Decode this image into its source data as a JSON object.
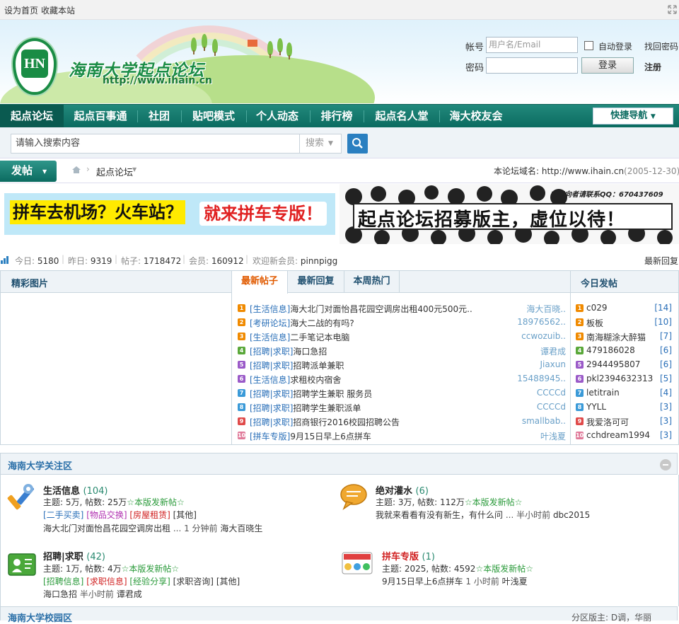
{
  "topbar": {
    "set_home": "设为首页",
    "bookmark": "收藏本站"
  },
  "header": {
    "site_name": "海南大学起点论坛",
    "site_url": "http://www.ihain.cn",
    "emblem_letters": "HN"
  },
  "login": {
    "account_label": "帐号",
    "account_placeholder": "用户名/Email",
    "auto_login": "自动登录",
    "forgot": "找回密码",
    "password_label": "密码",
    "login_button": "登录",
    "register": "注册"
  },
  "nav": {
    "items": [
      "起点论坛",
      "起点百事通",
      "社团",
      "贴吧模式",
      "个人动态",
      "排行榜",
      "起点名人堂",
      "海大校友会"
    ],
    "quick_nav": "快捷导航"
  },
  "search": {
    "placeholder": "请输入搜索内容",
    "type": "搜索"
  },
  "postbar": {
    "post_button": "发帖",
    "breadcrumb": "起点论坛",
    "domain_label": "本论坛域名:",
    "domain": "http://www.ihain.cn",
    "domain_date": "(2005-12-30)"
  },
  "banners": {
    "left_yellow": "拼车去机场？火车站？",
    "left_red": "就来拼车专版！",
    "right_main": "起点论坛招募版主，虚位以待！",
    "right_top": "有意向者请联系QQ：670437609"
  },
  "stats": {
    "today_label": "今日:",
    "today": "5180",
    "yesterday_label": "昨日:",
    "yesterday": "9319",
    "posts_label": "帖子:",
    "posts": "1718472",
    "members_label": "会员:",
    "members": "160912",
    "welcome_label": "欢迎新会员:",
    "new_member": "pinnpigg",
    "latest_reply": "最新回复"
  },
  "panel": {
    "pics_title": "精彩图片",
    "tabs": [
      "最新帖子",
      "最新回复",
      "本周热门"
    ],
    "today_title": "今日发帖",
    "threads": [
      {
        "n": "1",
        "cat": "[生活信息]",
        "title": "海大北门对面怡昌花园空调房出租400元500元..",
        "author": "海大百晓..",
        "color": "#f08a00"
      },
      {
        "n": "2",
        "cat": "[考研论坛]",
        "title": "海大二战的有吗?",
        "author": "18976562..",
        "color": "#f08a00"
      },
      {
        "n": "3",
        "cat": "[生活信息]",
        "title": "二手笔记本电脑",
        "author": "ccwozuib..",
        "color": "#f08a00"
      },
      {
        "n": "4",
        "cat": "[招聘|求职]",
        "title": "海口急招",
        "author": "谭君成",
        "color": "#5aa83a"
      },
      {
        "n": "5",
        "cat": "[招聘|求职]",
        "title": "招聘派单兼职",
        "author": "Jiaxun",
        "color": "#9a5ac8"
      },
      {
        "n": "6",
        "cat": "[生活信息]",
        "title": "求租校内宿舍",
        "author": "15488945..",
        "color": "#9a5ac8"
      },
      {
        "n": "7",
        "cat": "[招聘|求职]",
        "title": "招聘学生兼职 服务员",
        "author": "CCCCd",
        "color": "#3a9ad8"
      },
      {
        "n": "8",
        "cat": "[招聘|求职]",
        "title": "招聘学生兼职派单",
        "author": "CCCCd",
        "color": "#3a9ad8"
      },
      {
        "n": "9",
        "cat": "[招聘|求职]",
        "title": "招商银行2016校园招聘公告",
        "author": "smallbab..",
        "color": "#e04a4a"
      },
      {
        "n": "10",
        "cat": "[拼车专版]",
        "title": "9月15日早上6点拼车",
        "author": "叶浅夏",
        "color": "#e07a9a"
      }
    ],
    "today_posts": [
      {
        "n": "1",
        "name": "c029",
        "count": "[14]",
        "color": "#f08a00"
      },
      {
        "n": "2",
        "name": "板板",
        "count": "[10]",
        "color": "#f08a00"
      },
      {
        "n": "3",
        "name": "南海糊涂大醉猫",
        "count": "[7]",
        "color": "#f08a00"
      },
      {
        "n": "4",
        "name": "479186028",
        "count": "[6]",
        "color": "#5aa83a"
      },
      {
        "n": "5",
        "name": "2944495807",
        "count": "[6]",
        "color": "#9a5ac8"
      },
      {
        "n": "6",
        "name": "pkl2394632313",
        "count": "[5]",
        "color": "#9a5ac8"
      },
      {
        "n": "7",
        "name": "letitrain",
        "count": "[4]",
        "color": "#3a9ad8"
      },
      {
        "n": "8",
        "name": "YYLL",
        "count": "[3]",
        "color": "#3a9ad8"
      },
      {
        "n": "9",
        "name": "我爱洛可可",
        "count": "[3]",
        "color": "#e04a4a"
      },
      {
        "n": "10",
        "name": "cchdream1994",
        "count": "[3]",
        "color": "#e07a9a"
      }
    ]
  },
  "focus": {
    "title": "海南大学关注区",
    "forums": [
      {
        "name": "生活信息",
        "count": "(104)",
        "stats": "主题: 5万, 帖数: 25万",
        "new": "☆本版发新帖☆",
        "tags": [
          "[二手买卖]",
          "[物品交换]",
          "[房屋租赁]",
          "[其他]"
        ],
        "last": "海大北门对面怡昌花园空调房出租",
        "last_time": "... 1 分钟前",
        "last_user": "海大百晓生"
      },
      {
        "name": "绝对灌水",
        "count": "(6)",
        "stats": "主题: 3万, 帖数: 112万",
        "new": "☆本版发新帖☆",
        "last": "我就来看看有没有新生，有什么问",
        "last_time": "... 半小时前",
        "last_user": "dbc2015"
      },
      {
        "name": "招聘|求职",
        "count": "(42)",
        "stats": "主题: 1万, 帖数: 4万",
        "new": "☆本版发新帖☆",
        "tags": [
          "[招聘信息]",
          "[求职信息]",
          "[经验分享]",
          "[求职咨询]",
          "[其他]"
        ],
        "last": "海口急招",
        "last_time": "半小时前",
        "last_user": "谭君成"
      },
      {
        "name": "拼车专版",
        "count": "(1)",
        "stats": "主题: 2025, 帖数: 4592",
        "new": "☆本版发新帖☆",
        "last": "9月15日早上6点拼车",
        "last_time": "1 小时前",
        "last_user": "叶浅夏"
      }
    ]
  },
  "campus": {
    "title": "海南大学校园区",
    "moderators": "分区版主: D调，华丽"
  }
}
